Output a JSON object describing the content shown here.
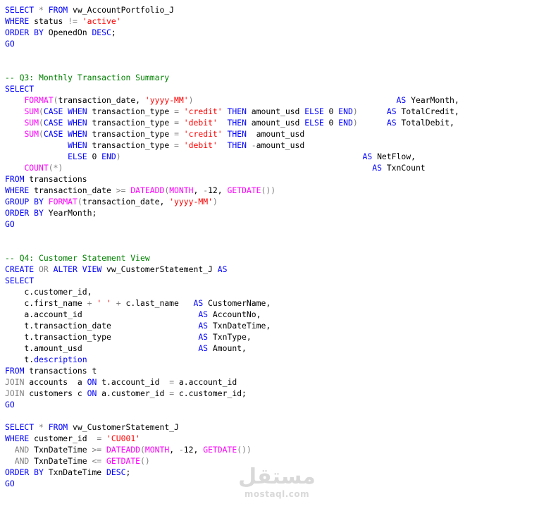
{
  "colors": {
    "keyword": "#0000ff",
    "function": "#ff00ff",
    "string": "#ff0000",
    "operator": "#808080",
    "comment": "#008000",
    "text": "#000000",
    "background": "#ffffff"
  },
  "code_lines": [
    [
      [
        "kw",
        "SELECT"
      ],
      [
        "plain",
        " "
      ],
      [
        "op",
        "*"
      ],
      [
        "plain",
        " "
      ],
      [
        "kw",
        "FROM"
      ],
      [
        "plain",
        " vw_AccountPortfolio_J"
      ]
    ],
    [
      [
        "kw",
        "WHERE"
      ],
      [
        "plain",
        " status "
      ],
      [
        "op",
        "!="
      ],
      [
        "plain",
        " "
      ],
      [
        "str",
        "'active'"
      ]
    ],
    [
      [
        "kw",
        "ORDER BY"
      ],
      [
        "plain",
        " OpenedOn "
      ],
      [
        "kw",
        "DESC"
      ],
      [
        "plain",
        ";"
      ]
    ],
    [
      [
        "kw",
        "GO"
      ]
    ],
    [],
    [],
    [
      [
        "cm",
        "-- Q3: Monthly Transaction Summary"
      ]
    ],
    [
      [
        "kw",
        "SELECT"
      ]
    ],
    [
      [
        "plain",
        "    "
      ],
      [
        "fn",
        "FORMAT"
      ],
      [
        "op",
        "("
      ],
      [
        "plain",
        "transaction_date, "
      ],
      [
        "str",
        "'yyyy-MM'"
      ],
      [
        "op",
        ")"
      ],
      [
        "plain",
        "                                          "
      ],
      [
        "kw",
        "AS"
      ],
      [
        "plain",
        " YearMonth,"
      ]
    ],
    [
      [
        "plain",
        "    "
      ],
      [
        "fn",
        "SUM"
      ],
      [
        "op",
        "("
      ],
      [
        "kw",
        "CASE WHEN"
      ],
      [
        "plain",
        " transaction_type "
      ],
      [
        "op",
        "="
      ],
      [
        "plain",
        " "
      ],
      [
        "str",
        "'credit'"
      ],
      [
        "plain",
        " "
      ],
      [
        "kw",
        "THEN"
      ],
      [
        "plain",
        " amount_usd "
      ],
      [
        "kw",
        "ELSE"
      ],
      [
        "plain",
        " 0 "
      ],
      [
        "kw",
        "END"
      ],
      [
        "op",
        ")"
      ],
      [
        "plain",
        "      "
      ],
      [
        "kw",
        "AS"
      ],
      [
        "plain",
        " TotalCredit,"
      ]
    ],
    [
      [
        "plain",
        "    "
      ],
      [
        "fn",
        "SUM"
      ],
      [
        "op",
        "("
      ],
      [
        "kw",
        "CASE WHEN"
      ],
      [
        "plain",
        " transaction_type "
      ],
      [
        "op",
        "="
      ],
      [
        "plain",
        " "
      ],
      [
        "str",
        "'debit'"
      ],
      [
        "plain",
        "  "
      ],
      [
        "kw",
        "THEN"
      ],
      [
        "plain",
        " amount_usd "
      ],
      [
        "kw",
        "ELSE"
      ],
      [
        "plain",
        " 0 "
      ],
      [
        "kw",
        "END"
      ],
      [
        "op",
        ")"
      ],
      [
        "plain",
        "      "
      ],
      [
        "kw",
        "AS"
      ],
      [
        "plain",
        " TotalDebit,"
      ]
    ],
    [
      [
        "plain",
        "    "
      ],
      [
        "fn",
        "SUM"
      ],
      [
        "op",
        "("
      ],
      [
        "kw",
        "CASE WHEN"
      ],
      [
        "plain",
        " transaction_type "
      ],
      [
        "op",
        "="
      ],
      [
        "plain",
        " "
      ],
      [
        "str",
        "'credit'"
      ],
      [
        "plain",
        " "
      ],
      [
        "kw",
        "THEN"
      ],
      [
        "plain",
        "  amount_usd"
      ]
    ],
    [
      [
        "plain",
        "             "
      ],
      [
        "kw",
        "WHEN"
      ],
      [
        "plain",
        " transaction_type "
      ],
      [
        "op",
        "="
      ],
      [
        "plain",
        " "
      ],
      [
        "str",
        "'debit'"
      ],
      [
        "plain",
        "  "
      ],
      [
        "kw",
        "THEN"
      ],
      [
        "plain",
        " "
      ],
      [
        "op",
        "-"
      ],
      [
        "plain",
        "amount_usd"
      ]
    ],
    [
      [
        "plain",
        "             "
      ],
      [
        "kw",
        "ELSE"
      ],
      [
        "plain",
        " 0 "
      ],
      [
        "kw",
        "END"
      ],
      [
        "op",
        ")"
      ],
      [
        "plain",
        "                                                  "
      ],
      [
        "kw",
        "AS"
      ],
      [
        "plain",
        " NetFlow,"
      ]
    ],
    [
      [
        "plain",
        "    "
      ],
      [
        "fn",
        "COUNT"
      ],
      [
        "op",
        "(*)"
      ],
      [
        "plain",
        "                                                                "
      ],
      [
        "kw",
        "AS"
      ],
      [
        "plain",
        " TxnCount"
      ]
    ],
    [
      [
        "kw",
        "FROM"
      ],
      [
        "plain",
        " transactions"
      ]
    ],
    [
      [
        "kw",
        "WHERE"
      ],
      [
        "plain",
        " transaction_date "
      ],
      [
        "op",
        ">="
      ],
      [
        "plain",
        " "
      ],
      [
        "fn",
        "DATEADD"
      ],
      [
        "op",
        "("
      ],
      [
        "fn",
        "MONTH"
      ],
      [
        "plain",
        ", "
      ],
      [
        "op",
        "-"
      ],
      [
        "plain",
        "12, "
      ],
      [
        "fn",
        "GETDATE"
      ],
      [
        "op",
        "())"
      ]
    ],
    [
      [
        "kw",
        "GROUP BY"
      ],
      [
        "plain",
        " "
      ],
      [
        "fn",
        "FORMAT"
      ],
      [
        "op",
        "("
      ],
      [
        "plain",
        "transaction_date, "
      ],
      [
        "str",
        "'yyyy-MM'"
      ],
      [
        "op",
        ")"
      ]
    ],
    [
      [
        "kw",
        "ORDER BY"
      ],
      [
        "plain",
        " YearMonth;"
      ]
    ],
    [
      [
        "kw",
        "GO"
      ]
    ],
    [],
    [],
    [
      [
        "cm",
        "-- Q4: Customer Statement View"
      ]
    ],
    [
      [
        "kw",
        "CREATE"
      ],
      [
        "plain",
        " "
      ],
      [
        "op",
        "OR"
      ],
      [
        "plain",
        " "
      ],
      [
        "kw",
        "ALTER VIEW"
      ],
      [
        "plain",
        " vw_CustomerStatement_J "
      ],
      [
        "kw",
        "AS"
      ]
    ],
    [
      [
        "kw",
        "SELECT"
      ]
    ],
    [
      [
        "plain",
        "    c.customer_id,"
      ]
    ],
    [
      [
        "plain",
        "    c.first_name "
      ],
      [
        "op",
        "+"
      ],
      [
        "plain",
        " "
      ],
      [
        "str",
        "' '"
      ],
      [
        "plain",
        " "
      ],
      [
        "op",
        "+"
      ],
      [
        "plain",
        " c.last_name   "
      ],
      [
        "kw",
        "AS"
      ],
      [
        "plain",
        " CustomerName,"
      ]
    ],
    [
      [
        "plain",
        "    a.account_id                        "
      ],
      [
        "kw",
        "AS"
      ],
      [
        "plain",
        " AccountNo,"
      ]
    ],
    [
      [
        "plain",
        "    t.transaction_date                  "
      ],
      [
        "kw",
        "AS"
      ],
      [
        "plain",
        " TxnDateTime,"
      ]
    ],
    [
      [
        "plain",
        "    t.transaction_type                  "
      ],
      [
        "kw",
        "AS"
      ],
      [
        "plain",
        " TxnType,"
      ]
    ],
    [
      [
        "plain",
        "    t.amount_usd                        "
      ],
      [
        "kw",
        "AS"
      ],
      [
        "plain",
        " Amount,"
      ]
    ],
    [
      [
        "plain",
        "    t."
      ],
      [
        "kw",
        "description"
      ]
    ],
    [
      [
        "kw",
        "FROM"
      ],
      [
        "plain",
        " transactions t"
      ]
    ],
    [
      [
        "op",
        "JOIN"
      ],
      [
        "plain",
        " accounts  a "
      ],
      [
        "kw",
        "ON"
      ],
      [
        "plain",
        " t.account_id  "
      ],
      [
        "op",
        "="
      ],
      [
        "plain",
        " a.account_id"
      ]
    ],
    [
      [
        "op",
        "JOIN"
      ],
      [
        "plain",
        " customers c "
      ],
      [
        "kw",
        "ON"
      ],
      [
        "plain",
        " a.customer_id "
      ],
      [
        "op",
        "="
      ],
      [
        "plain",
        " c.customer_id;"
      ]
    ],
    [
      [
        "kw",
        "GO"
      ]
    ],
    [],
    [
      [
        "kw",
        "SELECT"
      ],
      [
        "plain",
        " "
      ],
      [
        "op",
        "*"
      ],
      [
        "plain",
        " "
      ],
      [
        "kw",
        "FROM"
      ],
      [
        "plain",
        " vw_CustomerStatement_J"
      ]
    ],
    [
      [
        "kw",
        "WHERE"
      ],
      [
        "plain",
        " customer_id  "
      ],
      [
        "op",
        "="
      ],
      [
        "plain",
        " "
      ],
      [
        "str",
        "'CU001'"
      ]
    ],
    [
      [
        "plain",
        "  "
      ],
      [
        "op",
        "AND"
      ],
      [
        "plain",
        " TxnDateTime "
      ],
      [
        "op",
        ">="
      ],
      [
        "plain",
        " "
      ],
      [
        "fn",
        "DATEADD"
      ],
      [
        "op",
        "("
      ],
      [
        "fn",
        "MONTH"
      ],
      [
        "plain",
        ", "
      ],
      [
        "op",
        "-"
      ],
      [
        "plain",
        "12, "
      ],
      [
        "fn",
        "GETDATE"
      ],
      [
        "op",
        "())"
      ]
    ],
    [
      [
        "plain",
        "  "
      ],
      [
        "op",
        "AND"
      ],
      [
        "plain",
        " TxnDateTime "
      ],
      [
        "op",
        "<="
      ],
      [
        "plain",
        " "
      ],
      [
        "fn",
        "GETDATE"
      ],
      [
        "op",
        "()"
      ]
    ],
    [
      [
        "kw",
        "ORDER BY"
      ],
      [
        "plain",
        " TxnDateTime "
      ],
      [
        "kw",
        "DESC"
      ],
      [
        "plain",
        ";"
      ]
    ],
    [
      [
        "kw",
        "GO"
      ]
    ]
  ],
  "watermark": {
    "arabic": "مستقل",
    "latin": "mostaql.com"
  }
}
